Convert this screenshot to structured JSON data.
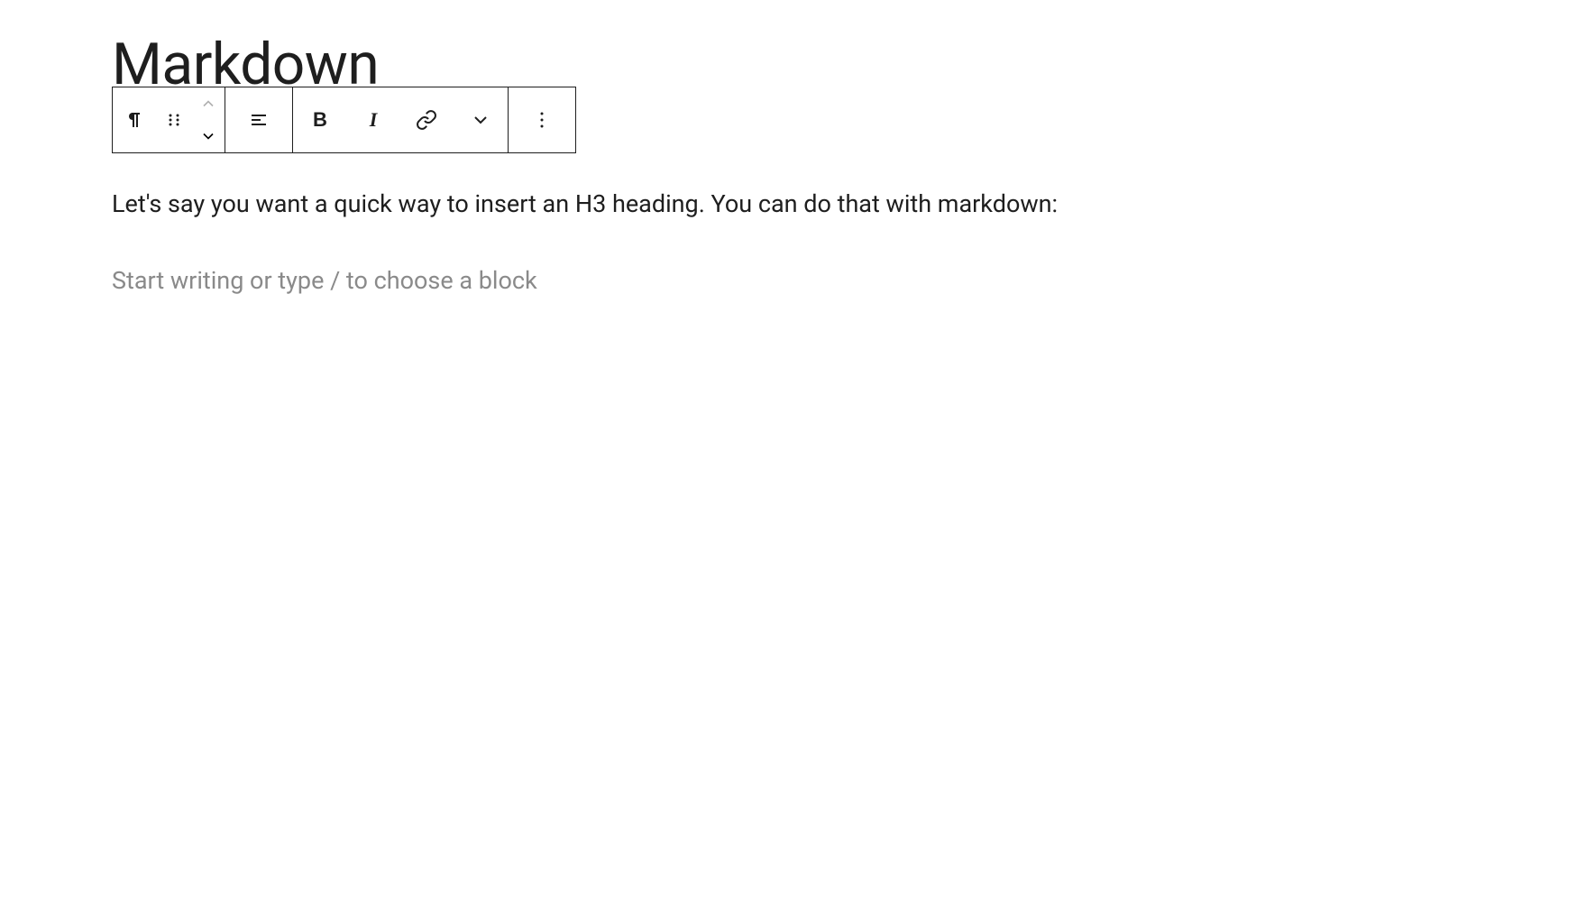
{
  "title": "Markdown",
  "toolbar": {
    "bold_label": "B",
    "italic_label": "I"
  },
  "content": {
    "paragraph": "Let's say you want a quick way to insert an H3 heading. You can do that with markdown:",
    "placeholder": "Start writing or type / to choose a block"
  }
}
